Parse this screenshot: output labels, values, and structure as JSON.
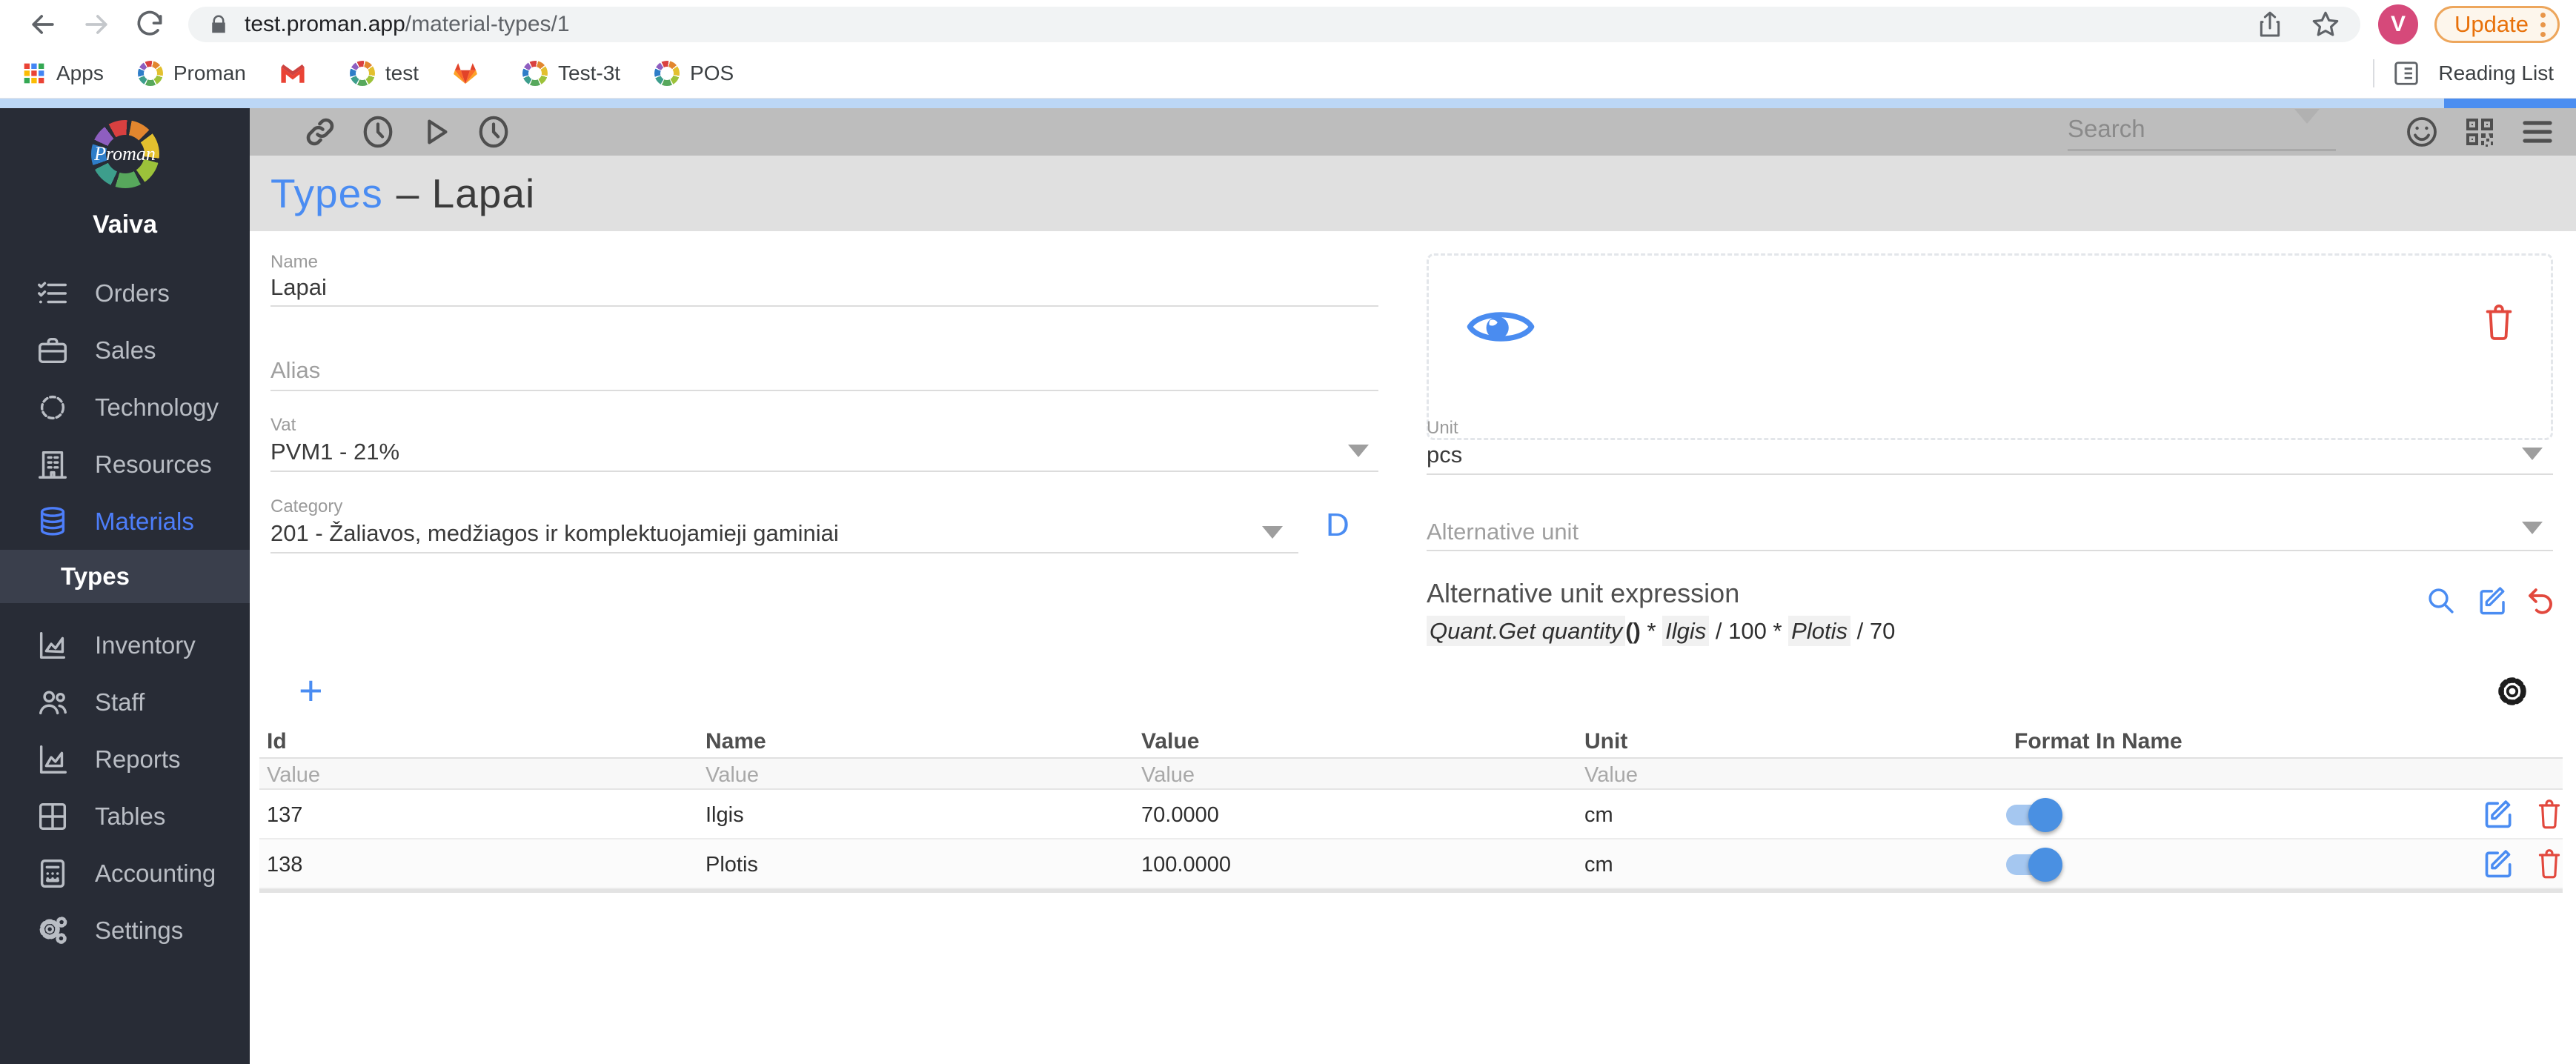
{
  "colors": {
    "accent_blue": "#4a8cf2",
    "toggle_on": "#4a90e2",
    "danger_red": "#e2483d",
    "sidebar_active": "#4d7efa",
    "strip_light": "#bcd7f6",
    "strip_dark": "#4b8ef1"
  },
  "browser": {
    "url_host": "test.proman.app",
    "url_path": "/material-types/1",
    "avatar_letter": "V",
    "update_button": "Update",
    "reading_list_label": "Reading List",
    "bookmarks": [
      {
        "icon": "apps-grid",
        "label": "Apps"
      },
      {
        "icon": "proman-logo",
        "label": "Proman"
      },
      {
        "icon": "gmail",
        "label": ""
      },
      {
        "icon": "proman-logo",
        "label": "test"
      },
      {
        "icon": "gitlab",
        "label": ""
      },
      {
        "icon": "proman-logo",
        "label": "Test-3t"
      },
      {
        "icon": "prochef-logo",
        "label": "POS"
      }
    ]
  },
  "sidebar": {
    "logo_text": "Proman",
    "user": "Vaiva",
    "items": [
      {
        "label": "Orders",
        "icon": "checklist-icon"
      },
      {
        "label": "Sales",
        "icon": "briefcase-icon"
      },
      {
        "label": "Technology",
        "icon": "badge-icon"
      },
      {
        "label": "Resources",
        "icon": "building-icon"
      },
      {
        "label": "Materials",
        "icon": "database-icon",
        "active": true
      },
      {
        "label": "Inventory",
        "icon": "factory-icon"
      },
      {
        "label": "Staff",
        "icon": "people-icon"
      },
      {
        "label": "Reports",
        "icon": "chart-icon"
      },
      {
        "label": "Tables",
        "icon": "table-icon"
      },
      {
        "label": "Accounting",
        "icon": "calculator-icon"
      },
      {
        "label": "Settings",
        "icon": "gears-icon"
      }
    ],
    "subitem": {
      "label": "Types",
      "active": true
    }
  },
  "toolbar": {
    "search_placeholder": "Search"
  },
  "page": {
    "title_section": "Types",
    "title_rest": "– Lapai"
  },
  "form": {
    "name": {
      "label": "Name",
      "value": "Lapai"
    },
    "alias": {
      "label": "Alias",
      "value": ""
    },
    "vat": {
      "label": "Vat",
      "value": "PVM1 - 21%"
    },
    "category": {
      "label": "Category",
      "value": "201 - Žaliavos, medžiagos ir komplektuojamieji gaminiai"
    },
    "d_button": "D",
    "unit": {
      "label": "Unit",
      "value": "pcs"
    },
    "alternative_unit": {
      "placeholder": "Alternative unit"
    },
    "expression": {
      "title": "Alternative unit expression",
      "tokens": [
        {
          "text": "Quant.Get quantity",
          "chip": true
        },
        {
          "text": "()",
          "chip": false,
          "paren": true
        },
        {
          "text": " * ",
          "chip": false
        },
        {
          "text": "Ilgis",
          "chip": true
        },
        {
          "text": " / 100 * ",
          "chip": false
        },
        {
          "text": "Plotis",
          "chip": true
        },
        {
          "text": " / 70",
          "chip": false
        }
      ]
    }
  },
  "table": {
    "headers": [
      "Id",
      "Name",
      "Value",
      "Unit",
      "Format In Name"
    ],
    "filters": [
      "Value",
      "Value",
      "Value",
      "Value"
    ],
    "rows": [
      {
        "id": "137",
        "name": "Ilgis",
        "value": "70.0000",
        "unit": "cm",
        "format_in_name": true
      },
      {
        "id": "138",
        "name": "Plotis",
        "value": "100.0000",
        "unit": "cm",
        "format_in_name": true
      }
    ]
  }
}
